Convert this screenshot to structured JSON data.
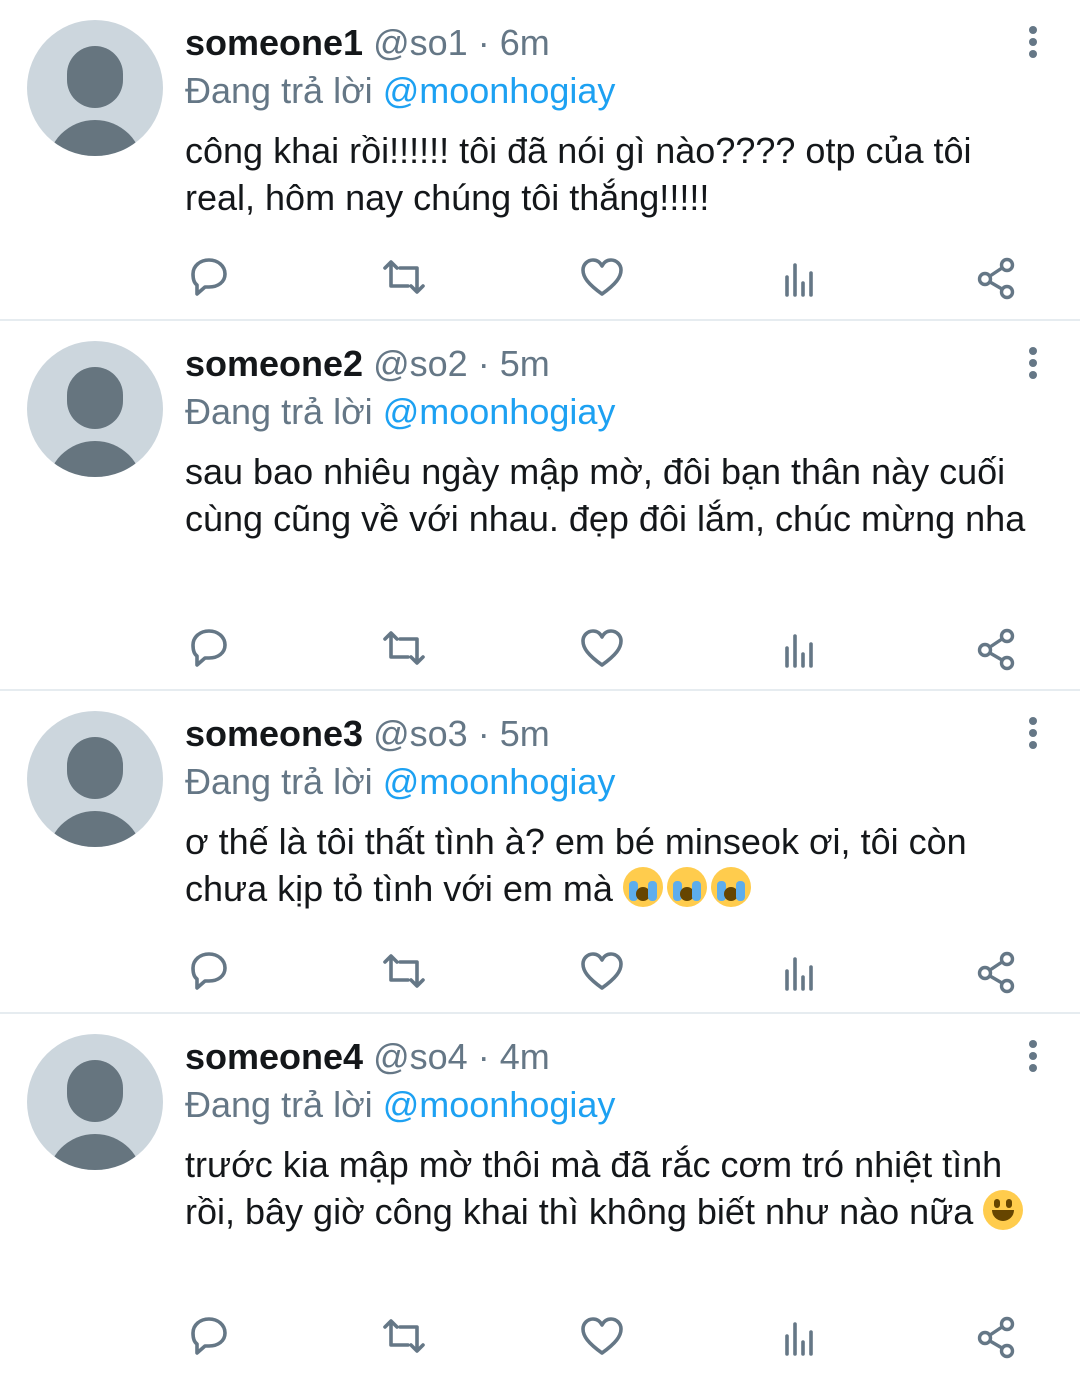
{
  "replies": [
    {
      "name": "someone1",
      "handle": "@so1",
      "time": "6m",
      "replying_prefix": "Đang trả lời",
      "replying_to": "@moonhogiay",
      "text": "công khai rồi!!!!!! tôi đã nói gì nào???? otp của tôi real, hôm nay chúng tôi thắng!!!!!"
    },
    {
      "name": "someone2",
      "handle": "@so2",
      "time": "5m",
      "replying_prefix": "Đang trả lời",
      "replying_to": "@moonhogiay",
      "text": "sau bao nhiêu ngày mập mờ, đôi bạn thân này cuối cùng cũng về với nhau. đẹp đôi lắm, chúc mừng nha"
    },
    {
      "name": "someone3",
      "handle": "@so3",
      "time": "5m",
      "replying_prefix": "Đang trả lời",
      "replying_to": "@moonhogiay",
      "text": "ơ thế là tôi thất tình à? em bé minseok ơi, tôi còn chưa kịp tỏ tình với em mà",
      "emojis": [
        "loudly-crying-face",
        "loudly-crying-face",
        "loudly-crying-face"
      ]
    },
    {
      "name": "someone4",
      "handle": "@so4",
      "time": "4m",
      "replying_prefix": "Đang trả lời",
      "replying_to": "@moonhogiay",
      "text": "trước kia mập mờ thôi mà đã rắc cơm tró nhiệt tình rồi, bây giờ công khai thì không biết như nào nữa",
      "emojis": [
        "grinning-face"
      ]
    }
  ],
  "icons": {
    "avatar": "default-avatar-icon",
    "more": "more-vertical-icon",
    "reply": "reply-icon",
    "retweet": "retweet-icon",
    "like": "heart-icon",
    "stats": "stats-icon",
    "share": "share-icon"
  },
  "colors": {
    "mention": "#1da1f2",
    "secondary_text": "#657786",
    "primary_text": "#14171a",
    "avatar_bg": "#ccd6dd",
    "avatar_fg": "#66757f",
    "divider": "#e6ecf0"
  }
}
